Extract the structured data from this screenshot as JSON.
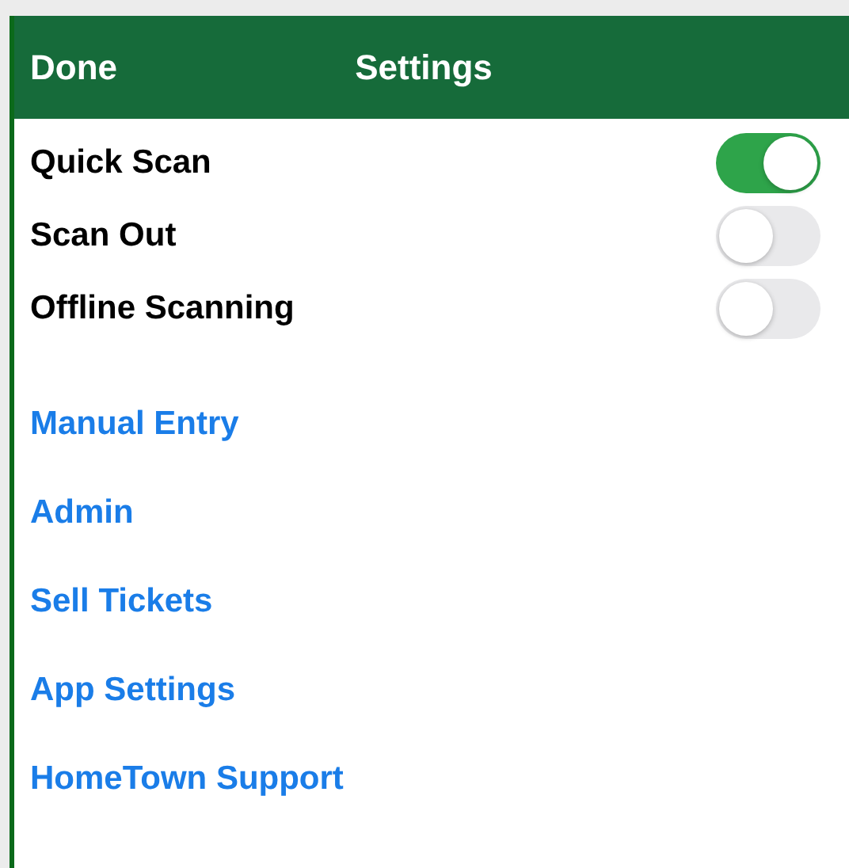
{
  "header": {
    "done": "Done",
    "title": "Settings"
  },
  "toggles": [
    {
      "label": "Quick Scan",
      "on": true
    },
    {
      "label": "Scan Out",
      "on": false
    },
    {
      "label": "Offline Scanning",
      "on": false
    }
  ],
  "links": [
    "Manual Entry",
    "Admin",
    "Sell Tickets",
    "App Settings",
    "HomeTown Support"
  ]
}
